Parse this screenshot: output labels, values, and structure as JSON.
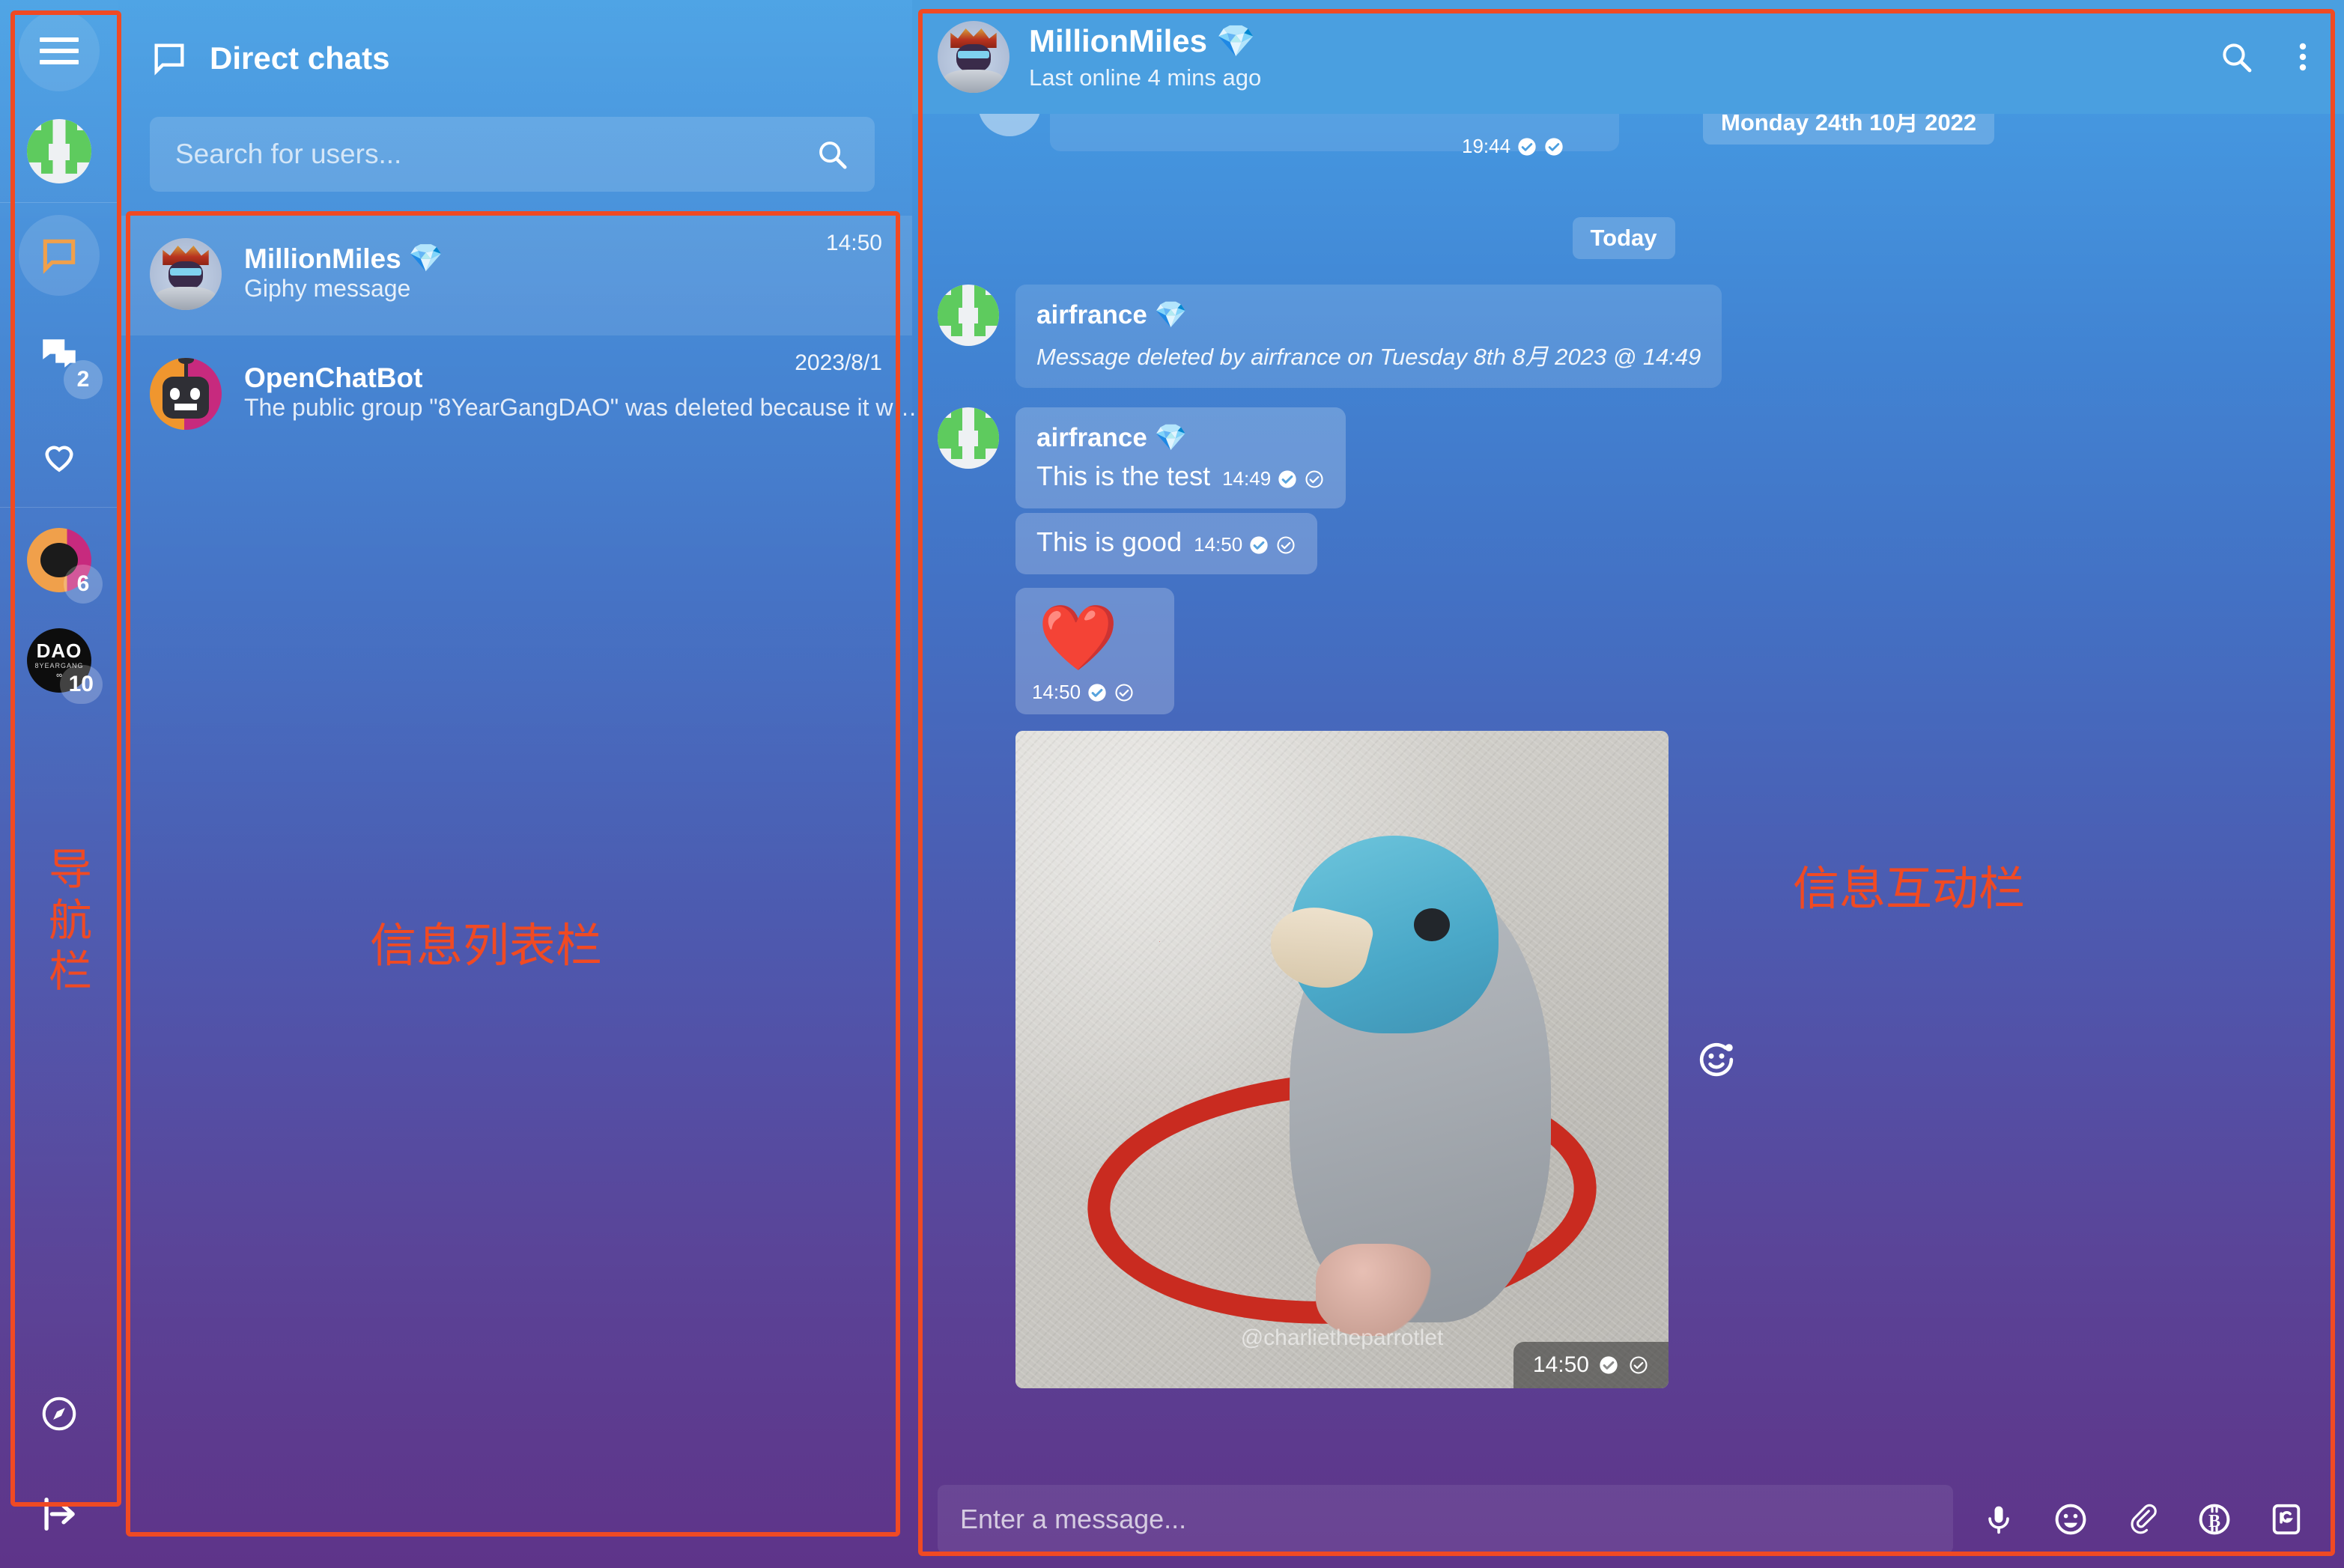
{
  "nav": {
    "items": [
      {
        "name": "menu",
        "icon": "hamburger-icon",
        "badge": null
      },
      {
        "name": "profile",
        "icon": "user-avatar",
        "badge": null
      },
      {
        "name": "direct-chats",
        "icon": "chat-bubble-icon",
        "badge": null
      },
      {
        "name": "groups",
        "icon": "group-chats-icon",
        "badge": "2"
      },
      {
        "name": "favourites",
        "icon": "heart-icon",
        "badge": null
      },
      {
        "name": "community-openchat",
        "icon": "community-avatar",
        "badge": "6"
      },
      {
        "name": "community-dao",
        "icon": "dao-avatar",
        "badge": "10"
      },
      {
        "name": "explore",
        "icon": "compass-icon",
        "badge": null
      },
      {
        "name": "collapse",
        "icon": "collapse-arrow-icon",
        "badge": null
      }
    ],
    "dao_avatar": {
      "line1": "DAO",
      "line2": "8YEARGANG",
      "line3": "∞"
    }
  },
  "chat_list": {
    "header_title": "Direct chats",
    "header_icon": "chat-bubble-icon",
    "search_placeholder": "Search for users...",
    "search_icon": "search-icon",
    "items": [
      {
        "name": "MillionMiles",
        "badge_emoji": "💎",
        "preview": "Giphy message",
        "time": "14:50",
        "avatar": "king-avatar",
        "selected": true
      },
      {
        "name": "OpenChatBot",
        "badge_emoji": "",
        "preview": "The public group \"8YearGangDAO\" was deleted because it w…",
        "time": "2023/8/1",
        "avatar": "bot-avatar",
        "selected": false
      }
    ]
  },
  "conversation": {
    "title": "MillionMiles",
    "title_badge": "💎",
    "status": "Last online 4 mins ago",
    "header_icons": [
      "search-icon",
      "more-vertical-icon"
    ],
    "top_partial": {
      "time": "19:44"
    },
    "date_dividers": [
      {
        "label": "Monday 24th 10月 2022"
      },
      {
        "label": "Today"
      }
    ],
    "messages": [
      {
        "type": "deleted",
        "author": "airfrance",
        "author_badge": "💎",
        "text": "Message deleted by airfrance on Tuesday 8th 8月 2023 @ 14:49"
      },
      {
        "type": "text",
        "author": "airfrance",
        "author_badge": "💎",
        "text": "This is the test",
        "time": "14:49",
        "ticks": 2
      },
      {
        "type": "text",
        "author": "",
        "author_badge": "",
        "text": "This is good",
        "time": "14:50",
        "ticks": 2
      },
      {
        "type": "emoji",
        "emoji": "❤️",
        "time": "14:50",
        "ticks": 2
      },
      {
        "type": "image",
        "watermark": "@charlietheparrotlet",
        "time": "14:50",
        "ticks": 2,
        "reaction_icon": "add-reaction-icon"
      }
    ],
    "composer": {
      "placeholder": "Enter a message...",
      "icons": [
        "microphone-icon",
        "emoji-icon",
        "paperclip-icon",
        "bitcoin-icon",
        "giphy-icon"
      ]
    }
  },
  "annotations": {
    "accent_color": "#f04a23",
    "nav_label": "导航栏",
    "list_label": "信息列表栏",
    "conv_label": "信息互动栏"
  }
}
